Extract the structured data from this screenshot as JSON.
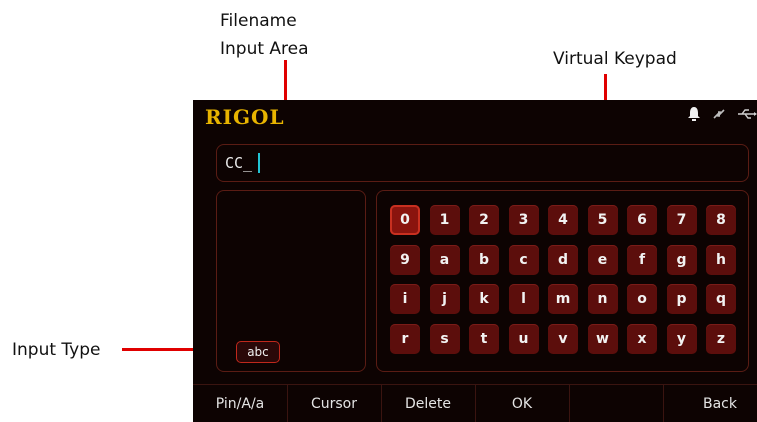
{
  "callouts": {
    "filename_line1": "Filename",
    "filename_line2": "Input Area",
    "keypad": "Virtual Keypad",
    "input_type": "Input Type"
  },
  "header": {
    "logo": "RIGOL",
    "icons": [
      "bell-icon",
      "sync-icon",
      "usb-icon"
    ]
  },
  "filename": {
    "value": "CC_"
  },
  "input_type": {
    "label": "abc"
  },
  "keypad": {
    "rows": [
      [
        "0",
        "1",
        "2",
        "3",
        "4",
        "5",
        "6",
        "7",
        "8"
      ],
      [
        "9",
        "a",
        "b",
        "c",
        "d",
        "e",
        "f",
        "g",
        "h"
      ],
      [
        "i",
        "j",
        "k",
        "l",
        "m",
        "n",
        "o",
        "p",
        "q"
      ],
      [
        "r",
        "s",
        "t",
        "u",
        "v",
        "w",
        "x",
        "y",
        "z"
      ]
    ],
    "selected": "0"
  },
  "softkeys": [
    "Pin/A/a",
    "Cursor",
    "Delete",
    "OK",
    "",
    "Back"
  ],
  "colors": {
    "accent": "#e8b400",
    "arrow": "#e00000",
    "key": "#5c0e0c",
    "cursor": "#22c4d4"
  }
}
